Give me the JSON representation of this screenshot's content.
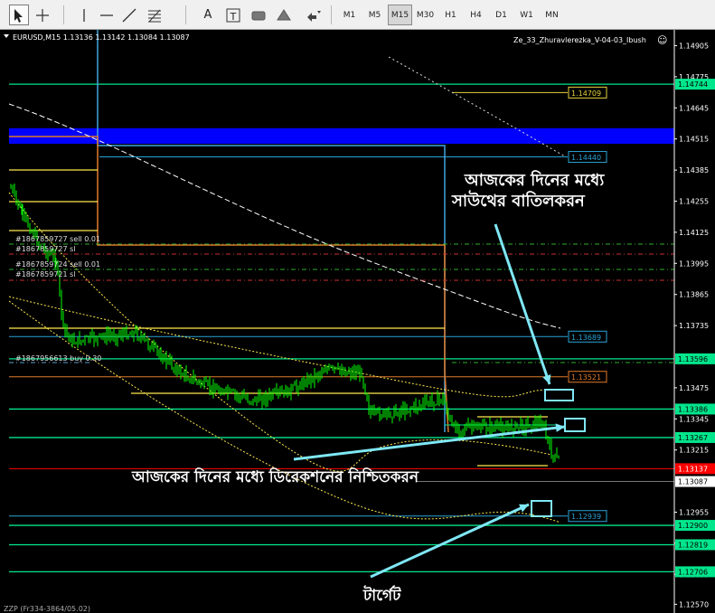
{
  "toolbar": {
    "tools": [
      "cursor-icon",
      "crosshair-icon",
      "vertical-line-icon",
      "horizontal-line-icon",
      "trendline-icon",
      "fibonacci-icon",
      "text-icon",
      "text-label-icon",
      "rectangle-icon",
      "triangle-icon",
      "arrows-menu-icon"
    ],
    "text_tool": "A",
    "timeframes": [
      "M1",
      "M5",
      "M15",
      "M30",
      "H1",
      "H4",
      "D1",
      "W1",
      "MN"
    ],
    "active_timeframe": "M15"
  },
  "chart": {
    "symbol_header": "EURUSD,M15  1.13136 1.13142 1.13084 1.13087",
    "indicator_name": "Ze_33_Zhuravlerezka_V-04-03_Ibush",
    "smiley": "☺",
    "price_ticks": [
      "1.14905",
      "1.14775",
      "1.14645",
      "1.14515",
      "1.14385",
      "1.14255",
      "1.14125",
      "1.13995",
      "1.13865",
      "1.13735",
      "1.13475",
      "1.13345",
      "1.13215",
      "1.12955",
      "1.12825",
      "1.12695",
      "1.12570"
    ],
    "highlighted_prices": [
      {
        "text": "1.14744",
        "kind": "level"
      },
      {
        "text": "1.13596",
        "kind": "level"
      },
      {
        "text": "1.13386",
        "kind": "level"
      },
      {
        "text": "1.13267",
        "kind": "level"
      },
      {
        "text": "1.12900",
        "kind": "level"
      },
      {
        "text": "1.12819",
        "kind": "level"
      },
      {
        "text": "1.12706",
        "kind": "level"
      },
      {
        "text": "1.13137",
        "kind": "bid"
      },
      {
        "text": "1.13087",
        "kind": "current"
      }
    ],
    "in_chart_labels": [
      {
        "text": "1.14709",
        "color": "#e6d23c"
      },
      {
        "text": "1.14440",
        "color": "#2aa3d6"
      },
      {
        "text": "1.13689",
        "color": "#2aa3d6"
      },
      {
        "text": "1.13521",
        "color": "#e07a2a"
      },
      {
        "text": "1.12939",
        "color": "#2aa3d6"
      }
    ],
    "order_labels": [
      "#1867859727 sell 0.01",
      "#1867859727 sl",
      "#1867859724 sell 0.01",
      "#1867859721 sl",
      "#1867956613 buy 0.30"
    ],
    "footer_text": "ZZP (Fr334-3864/05.02)",
    "colors": {
      "background": "#000000",
      "bull": "#00ff00",
      "level": "#00e68c",
      "blue_zone": "#0000ff",
      "bid_line": "#ff0000",
      "axis_text": "#ffffff"
    }
  },
  "annotations": {
    "cancel_text": "আজকের দিনের মধ্যে সাউথের বাতিলকরন",
    "direction_text": "আজকের দিনের মধ্যে ডিরেকশনের নিশ্চিতকরন",
    "target_text": "টার্গেট"
  }
}
